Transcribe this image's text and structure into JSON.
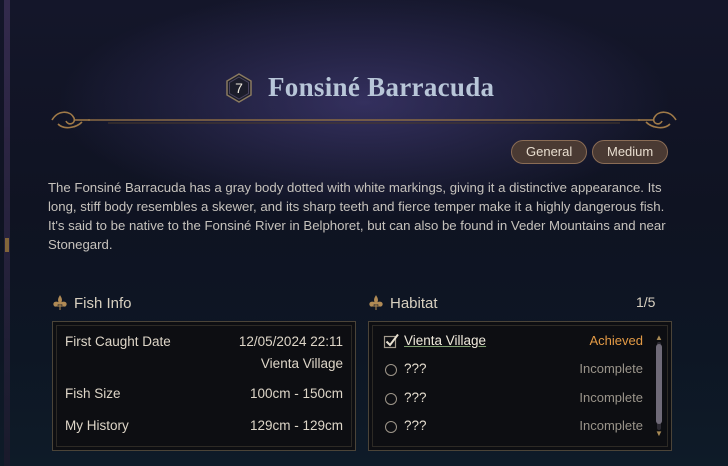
{
  "fish": {
    "level": "7",
    "name": "Fonsiné Barracuda",
    "tags": [
      "General",
      "Medium"
    ],
    "description": "The Fonsiné Barracuda has a gray body dotted with white markings, giving it a distinctive appearance. Its long, stiff body resembles a skewer, and its sharp teeth and fierce temper make it a highly dangerous fish. It's said to be native to the Fonsiné River in Belphoret, but can also be found in Veder Mountains and near Stonegard."
  },
  "fish_info": {
    "heading": "Fish Info",
    "first_caught_label": "First Caught Date",
    "first_caught_date": "12/05/2024 22:11",
    "first_caught_place": "Vienta Village",
    "size_label": "Fish Size",
    "size_value": "100cm - 150cm",
    "history_label": "My History",
    "history_value": "129cm - 129cm"
  },
  "habitat": {
    "heading": "Habitat",
    "count": "1/5",
    "items": [
      {
        "name": "Vienta Village",
        "status": "Achieved"
      },
      {
        "name": "???",
        "status": "Incomplete"
      },
      {
        "name": "???",
        "status": "Incomplete"
      },
      {
        "name": "???",
        "status": "Incomplete"
      }
    ]
  },
  "colors": {
    "achieved": "#e39a45",
    "accent_gold": "#a88a55",
    "title": "#b8c6d8"
  }
}
